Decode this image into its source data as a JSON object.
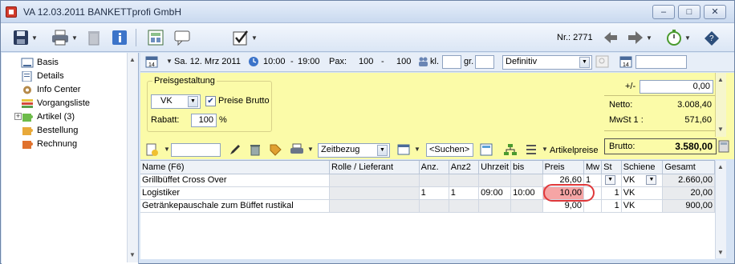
{
  "window": {
    "title": "VA 12.03.2011 BANKETTprofi GmbH",
    "controls": {
      "minimize": "–",
      "maximize": "□",
      "close": "✕"
    }
  },
  "toolbar": {
    "nr_label": "Nr.: 2771"
  },
  "nav": {
    "items": [
      {
        "label": "Basis",
        "icon": "form-icon"
      },
      {
        "label": "Details",
        "icon": "details-icon"
      },
      {
        "label": "Info Center",
        "icon": "gear-icon"
      },
      {
        "label": "Vorgangsliste",
        "icon": "list-icon"
      },
      {
        "label": "Artikel (3)",
        "icon": "puzzle-icon",
        "expandable": true,
        "expander": "+"
      },
      {
        "label": "Bestellung",
        "icon": "puzzle-icon"
      },
      {
        "label": "Rechnung",
        "icon": "puzzle-icon"
      }
    ]
  },
  "header": {
    "date": "Sa. 12. Mrz 2011",
    "time_from": "10:00",
    "time_sep": "-",
    "time_to": "19:00",
    "pax_label": "Pax:",
    "pax_from": "100",
    "pax_sep": "-",
    "pax_to": "100",
    "kl_label": "kl.",
    "kl_value": "",
    "gr_label": "gr.",
    "gr_value": "",
    "status": "Definitiv",
    "extra_value": ""
  },
  "pricing": {
    "group_title": "Preisgestaltung",
    "price_type": "VK",
    "preise_brutto_label": "Preise Brutto",
    "preise_brutto_checked": true,
    "rabatt_label": "Rabatt:",
    "rabatt_value": "100",
    "rabatt_unit": "%"
  },
  "totals": {
    "adjust_label": "+/-",
    "adjust_value": "0,00",
    "netto_label": "Netto:",
    "netto_value": "3.008,40",
    "mwst_label": "MwSt 1 :",
    "mwst_value": "571,60",
    "brutto_label": "Brutto:",
    "brutto_value": "3.580,00"
  },
  "gridbar": {
    "filter_value": "",
    "zeitbezug": "Zeitbezug",
    "search": "<Suchen>",
    "artikelpreise": "Artikelpreise"
  },
  "table": {
    "columns": [
      "Name (F6)",
      "Rolle / Lieferant",
      "Anz.",
      "Anz2",
      "Uhrzeit",
      "bis",
      "Preis",
      "Mw",
      "St",
      "Schiene",
      "Gesamt"
    ],
    "rows": [
      {
        "name": "Grillbüffet Cross Over",
        "rolle": "",
        "anz": "",
        "anz2": "",
        "uhrzeit": "",
        "bis": "",
        "preis": "26,60",
        "mw": "1",
        "st": "",
        "schiene": "VK",
        "gesamt": "2.660,00"
      },
      {
        "name": "Logistiker",
        "rolle": "",
        "anz": "1",
        "anz2": "1",
        "uhrzeit": "09:00",
        "bis": "10:00",
        "preis": "10,00",
        "mw": "",
        "st": "1",
        "schiene": "VK",
        "gesamt": "20,00"
      },
      {
        "name": "Getränkepauschale zum Büffet rustikal",
        "rolle": "",
        "anz": "",
        "anz2": "",
        "uhrzeit": "",
        "bis": "",
        "preis": "9,00",
        "mw": "",
        "st": "1",
        "schiene": "VK",
        "gesamt": "900,00"
      }
    ]
  },
  "colors": {
    "yellow_area": "#fbfba8",
    "highlight": "#e0383a",
    "price_cell": "#f6a5a5",
    "window_bg": "#d6e3f4"
  }
}
